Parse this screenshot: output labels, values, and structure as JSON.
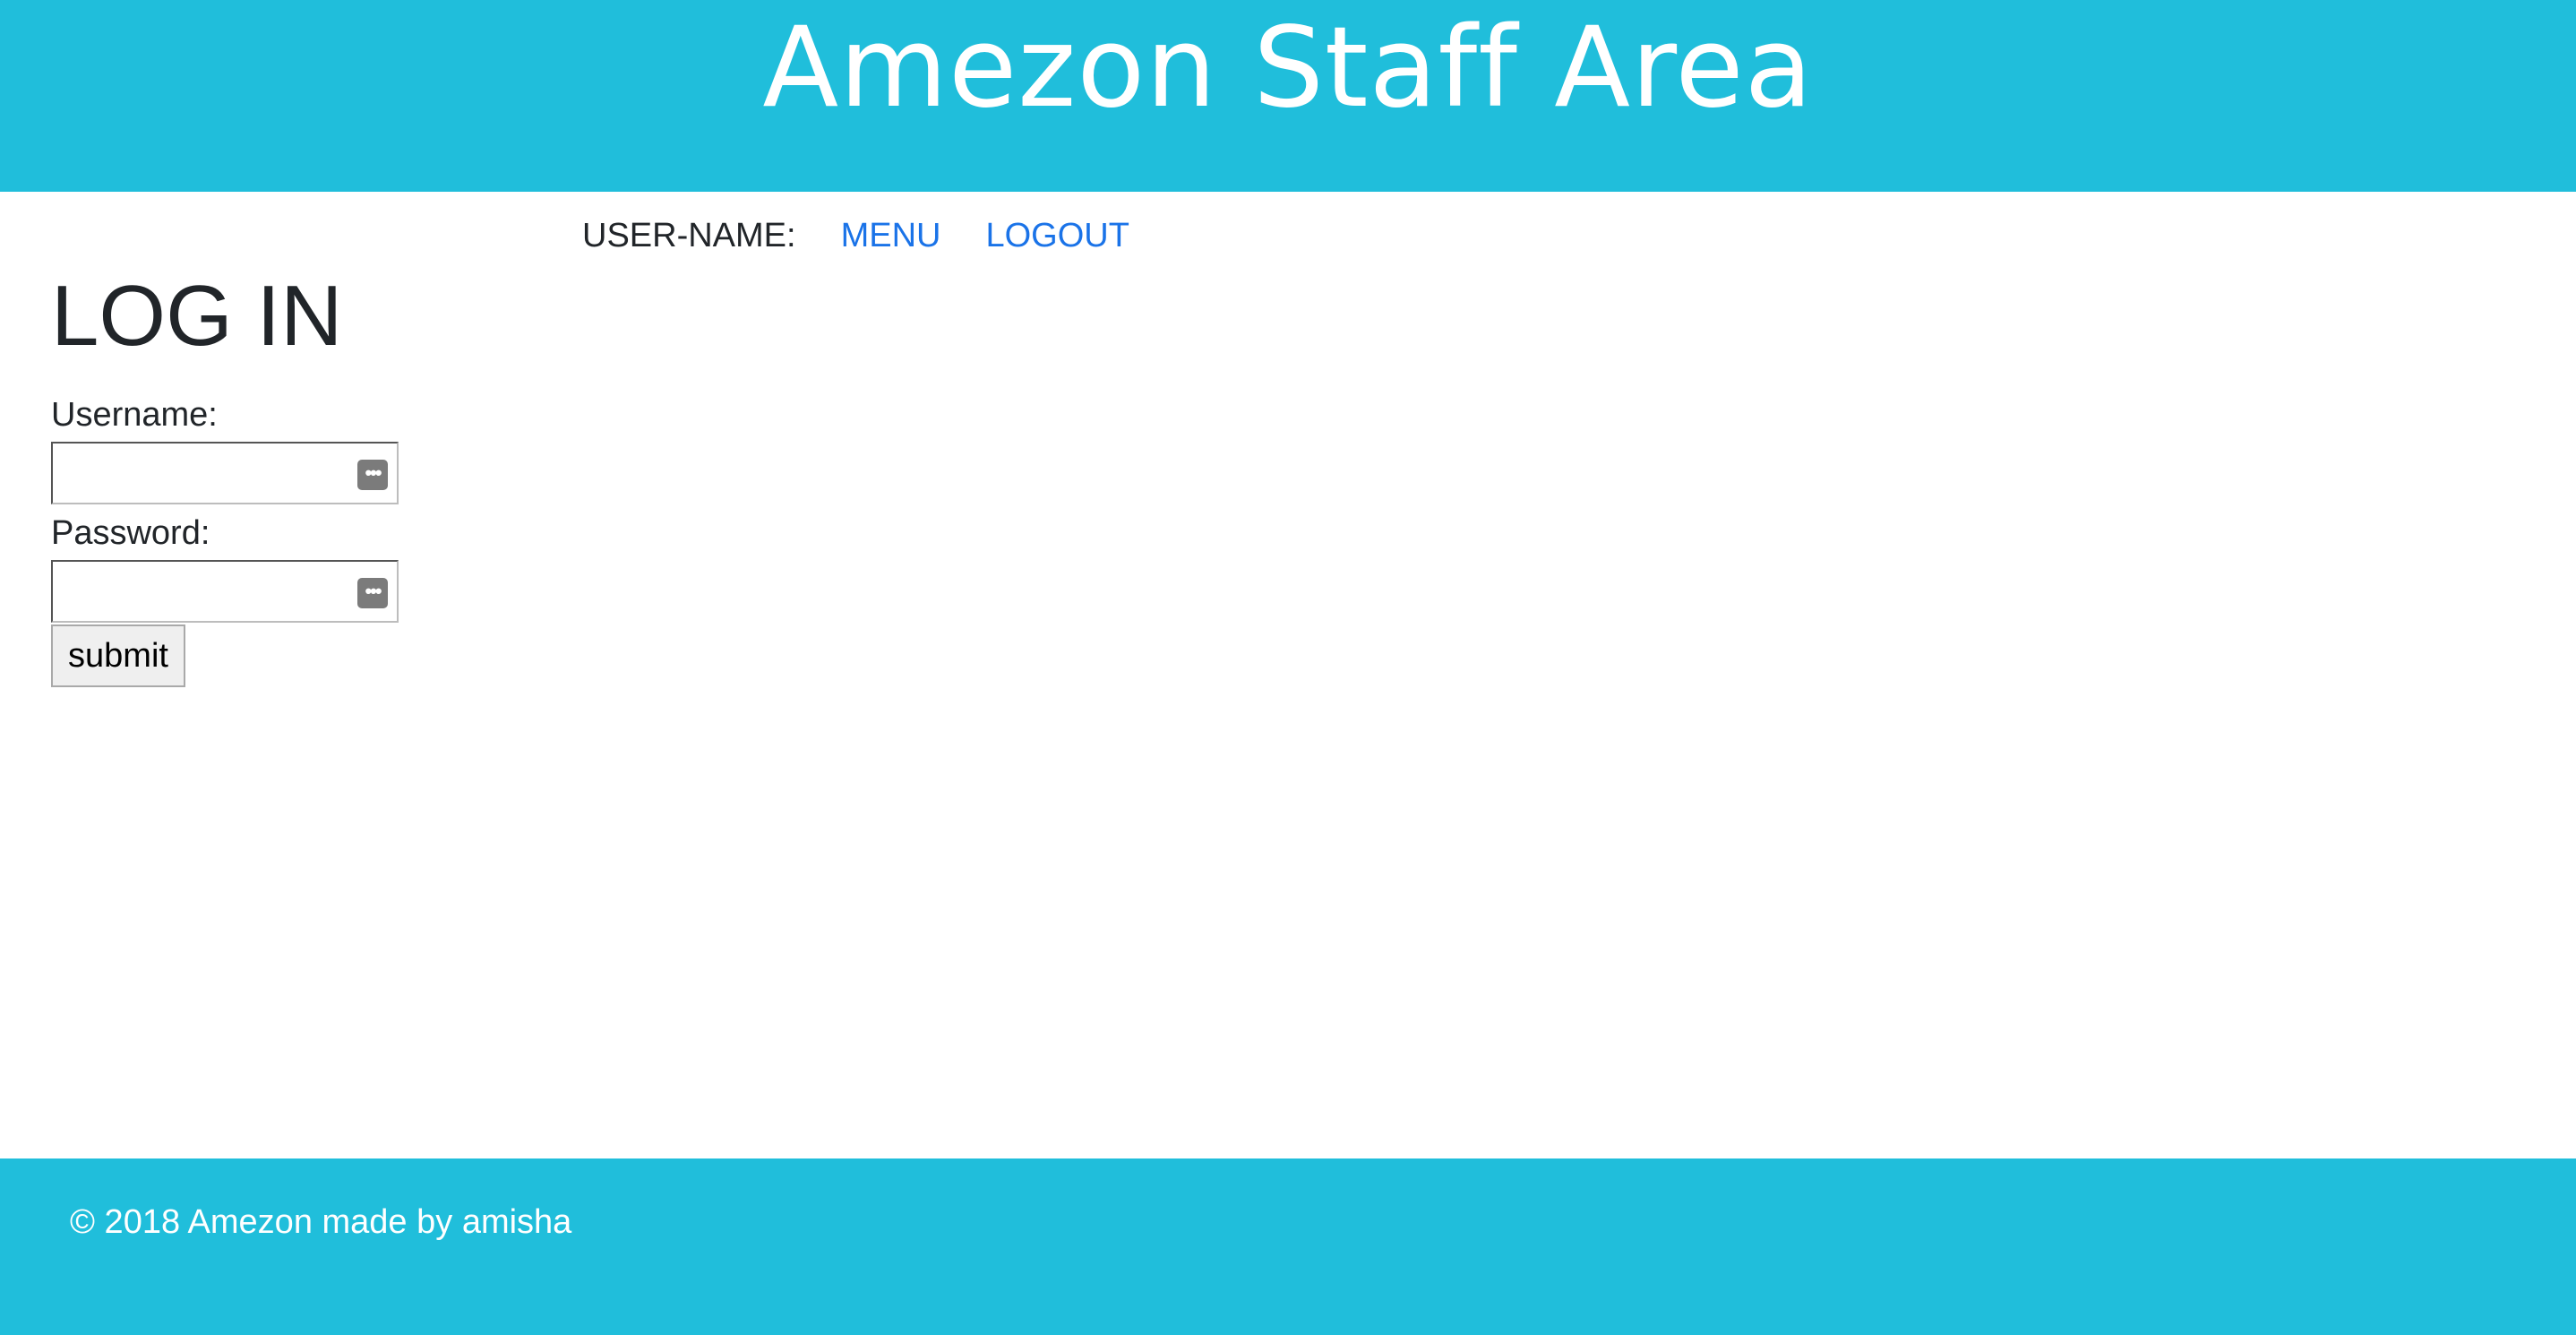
{
  "header": {
    "title": "Amezon Staff Area"
  },
  "nav": {
    "user_label": "USER-NAME:",
    "menu_label": "MENU",
    "logout_label": "LOGOUT"
  },
  "login": {
    "title": "LOG IN",
    "username_label": "Username:",
    "username_value": "",
    "password_label": "Password:",
    "password_value": "",
    "keychain_icon": "•••",
    "submit_label": "submit"
  },
  "footer": {
    "text": "© 2018 Amezon made by amisha"
  },
  "colors": {
    "brand_bar": "#20bedb",
    "link": "#1a73e8",
    "text": "#212529"
  },
  "icons": {
    "password_autofill": "keychain-autofill-icon"
  }
}
